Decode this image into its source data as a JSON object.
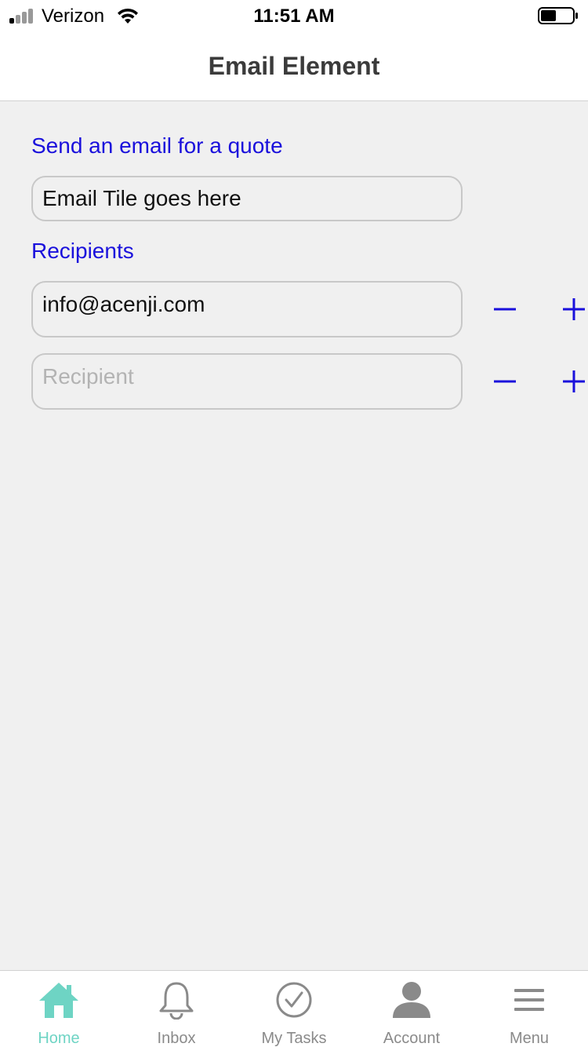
{
  "status_bar": {
    "carrier": "Verizon",
    "time": "11:51 AM"
  },
  "nav": {
    "title": "Email Element"
  },
  "form": {
    "email_section_label": "Send an email for a quote",
    "email_title_value": "Email Tile goes here",
    "recipients_label": "Recipients",
    "recipients": [
      {
        "value": "info@acenji.com",
        "placeholder": "Recipient"
      },
      {
        "value": "",
        "placeholder": "Recipient"
      }
    ]
  },
  "tabs": [
    {
      "label": "Home",
      "icon": "home-icon",
      "active": true
    },
    {
      "label": "Inbox",
      "icon": "bell-icon",
      "active": false
    },
    {
      "label": "My Tasks",
      "icon": "check-circle-icon",
      "active": false
    },
    {
      "label": "Account",
      "icon": "person-icon",
      "active": false
    },
    {
      "label": "Menu",
      "icon": "hamburger-menu-icon",
      "active": false
    }
  ],
  "colors": {
    "accent_blue": "#1a10dc",
    "active_tab": "#6ed4c4",
    "inactive_tab": "#8a8a8a",
    "background": "#f0f0f0"
  }
}
